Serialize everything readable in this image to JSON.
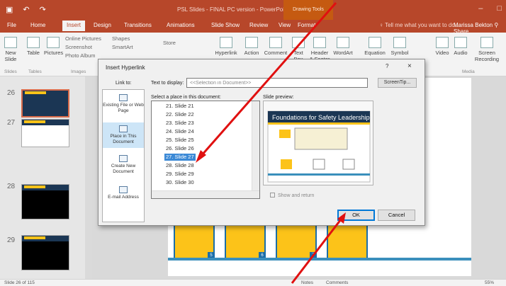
{
  "window": {
    "title": "PSL Slides - FINAL PC version - PowerPoint",
    "contextual_tab": "Drawing Tools",
    "accent_color": "#b7472a"
  },
  "tabs": [
    "File",
    "Home",
    "Insert",
    "Design",
    "Transitions",
    "Animations",
    "Slide Show",
    "Review",
    "View",
    "Format"
  ],
  "tell_me": "Tell me what you want to do...",
  "user_name": "Marissa Bekton",
  "share_label": "Share",
  "ribbon": {
    "new_slide": "New Slide",
    "table": "Table",
    "pictures": "Pictures",
    "online_pictures": "Online Pictures",
    "screenshot": "Screenshot",
    "photo_album": "Photo Album",
    "shapes": "Shapes",
    "smartart": "SmartArt",
    "store": "Store",
    "hyperlink": "Hyperlink",
    "action": "Action",
    "comment": "Comment",
    "text_box": "Text Box",
    "header_footer": "Header & Footer",
    "wordart": "WordArt",
    "equation": "Equation",
    "symbol": "Symbol",
    "video": "Video",
    "audio": "Audio",
    "screen_recording": "Screen Recording",
    "groups": {
      "slides": "Slides",
      "tables": "Tables",
      "images": "Images",
      "media": "Media"
    }
  },
  "slides_panel": {
    "numbers": [
      "26",
      "27",
      "28",
      "29"
    ],
    "selected": "26"
  },
  "status": {
    "slide_count": "Slide 26 of 115",
    "notes": "Notes",
    "comments": "Comments",
    "zoom": "55%"
  },
  "dialog": {
    "title": "Insert Hyperlink",
    "help": "?",
    "close": "×",
    "link_to_label": "Link to:",
    "text_to_display_label": "Text to display:",
    "text_to_display_value": "<<Selection in Document>>",
    "screentip_label": "ScreenTip...",
    "select_place_label": "Select a place in this document:",
    "slide_preview_label": "Slide preview:",
    "show_and_return": "Show and return",
    "ok": "OK",
    "cancel": "Cancel",
    "link_options": [
      {
        "label": "Existing File or Web Page",
        "icon": "globe-file-icon"
      },
      {
        "label": "Place in This Document",
        "icon": "document-place-icon"
      },
      {
        "label": "Create New Document",
        "icon": "new-document-icon"
      },
      {
        "label": "E-mail Address",
        "icon": "email-icon"
      }
    ],
    "slides": [
      "21. Slide 21",
      "22. Slide 22",
      "23. Slide 23",
      "24. Slide 24",
      "25. Slide 25",
      "26. Slide 26",
      "27. Slide 27",
      "28. Slide 28",
      "29. Slide 29",
      "30. Slide 30"
    ],
    "selected_slide": "27. Slide 27",
    "preview_title": "Foundations for Safety Leadership"
  }
}
